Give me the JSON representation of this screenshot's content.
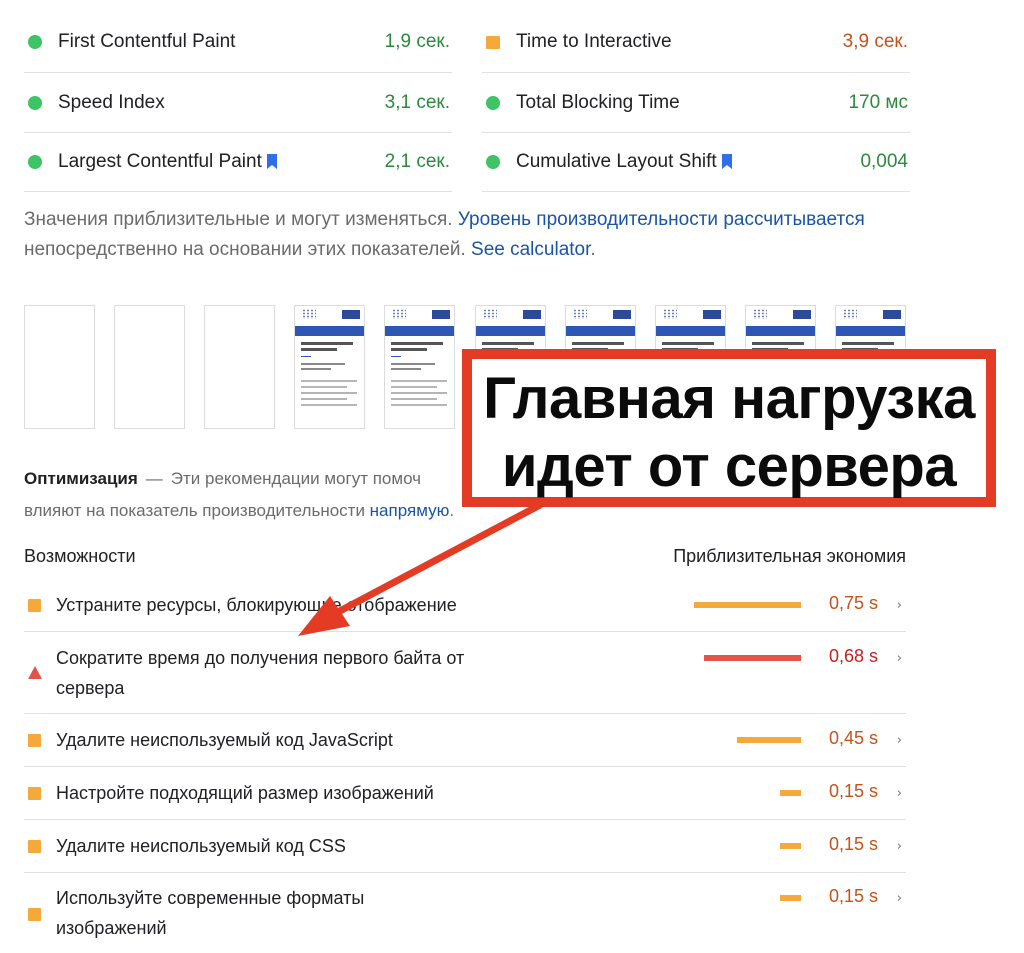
{
  "metrics": {
    "left": [
      {
        "label": "First Contentful Paint",
        "value": "1,9 сек.",
        "status": "good",
        "bookmark": false
      },
      {
        "label": "Speed Index",
        "value": "3,1 сек.",
        "status": "good",
        "bookmark": false
      },
      {
        "label": "Largest Contentful Paint",
        "value": "2,1 сек.",
        "status": "good",
        "bookmark": true
      }
    ],
    "right": [
      {
        "label": "Time to Interactive",
        "value": "3,9 сек.",
        "status": "average",
        "bookmark": false
      },
      {
        "label": "Total Blocking Time",
        "value": "170 мс",
        "status": "good",
        "bookmark": false
      },
      {
        "label": "Cumulative Layout Shift",
        "value": "0,004",
        "status": "good",
        "bookmark": true
      }
    ]
  },
  "note": {
    "text1": "Значения приблизительные и могут изменяться. ",
    "link1": "Уровень производительности рассчитывается",
    "text2": " непосредственно на основании этих показателей. ",
    "link2": "See calculator",
    "text3": "."
  },
  "filmstrip": {
    "blank_frames": 3,
    "page_frames": 7,
    "frame_title": "Продвижение сайтов в Яндекс",
    "frame_author": "Монс-эксперт Кузнецов Анатолий"
  },
  "optimization": {
    "title": "Оптимизация",
    "dash": "—",
    "text": "Эти рекомендации могут помоч",
    "text_line2": "влияют на показатель производительности ",
    "link": "напрямую",
    "text_end": "."
  },
  "columns": {
    "left": "Возможности",
    "right": "Приблизительная экономия"
  },
  "opportunities": [
    {
      "title": "Устраните ресурсы, блокирующие отображение",
      "value": "0,75 s",
      "severity": "average",
      "savings": 0.75
    },
    {
      "title": "Сократите время до получения первого байта от сервера",
      "value": "0,68 s",
      "severity": "fail",
      "savings": 0.68
    },
    {
      "title": "Удалите неиспользуемый код JavaScript",
      "value": "0,45 s",
      "severity": "average",
      "savings": 0.45
    },
    {
      "title": "Настройте подходящий размер изображений",
      "value": "0,15 s",
      "severity": "average",
      "savings": 0.15
    },
    {
      "title": "Удалите неиспользуемый код CSS",
      "value": "0,15 s",
      "severity": "average",
      "savings": 0.15
    },
    {
      "title": "Используйте современные форматы изображений",
      "value": "0,15 s",
      "severity": "average",
      "savings": 0.15
    }
  ],
  "callout": {
    "line1": "Главная нагрузка",
    "line2": "идет от сервера"
  },
  "colors": {
    "good": "#3ec464",
    "average": "#f4a93a",
    "fail": "#e4534a",
    "link": "#1a54a8",
    "annotation": "#e43b25"
  },
  "icons": {
    "good": "green-circle-icon",
    "average": "orange-square-icon",
    "fail": "red-triangle-icon",
    "bookmark": "bookmark-icon",
    "expand": "chevron-right-icon"
  }
}
